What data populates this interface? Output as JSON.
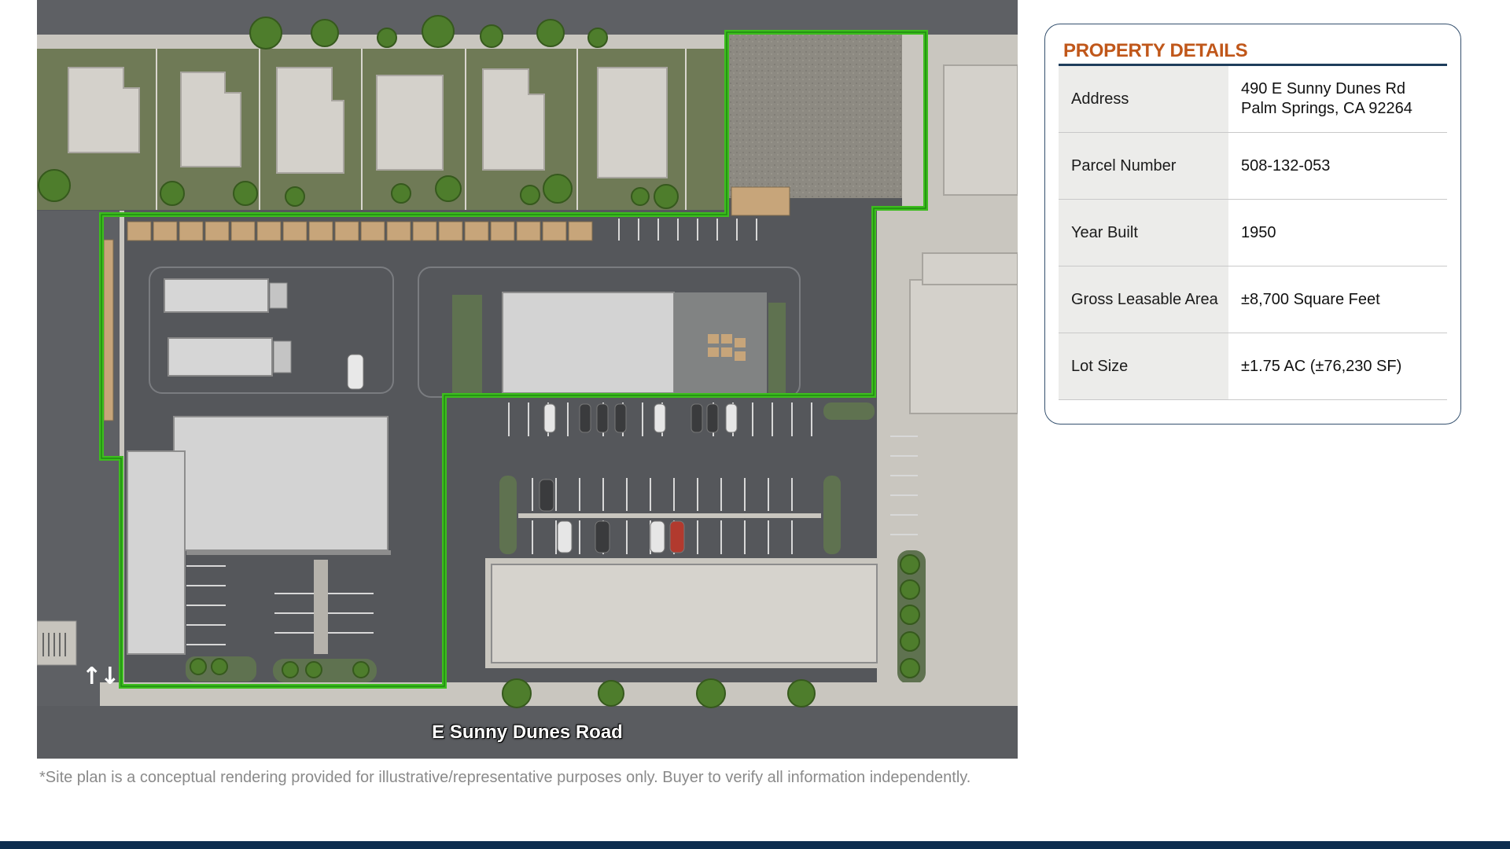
{
  "site_plan": {
    "road_label": "E Sunny Dunes Road",
    "arrow_icon": "north-south-arrows-icon",
    "boundary_color": "#3dbd1e",
    "disclaimer": "*Site plan is a conceptual rendering provided for illustrative/representative purposes only. Buyer to verify all information independently."
  },
  "property_details": {
    "title": "PROPERTY DETAILS",
    "accent_color": "#c0571a",
    "rows": [
      {
        "label": "Address",
        "value_line1": "490 E Sunny Dunes Rd",
        "value_line2": "Palm Springs, CA 92264"
      },
      {
        "label": "Parcel Number",
        "value_line1": "508-132-053"
      },
      {
        "label": "Year Built",
        "value_line1": "1950"
      },
      {
        "label": "Gross Leasable Area",
        "value_line1": "±8,700 Square Feet"
      },
      {
        "label": "Lot Size",
        "value_line1": "±1.75 AC (±76,230 SF)"
      }
    ]
  },
  "footer": {
    "color": "#0d2d4f"
  }
}
